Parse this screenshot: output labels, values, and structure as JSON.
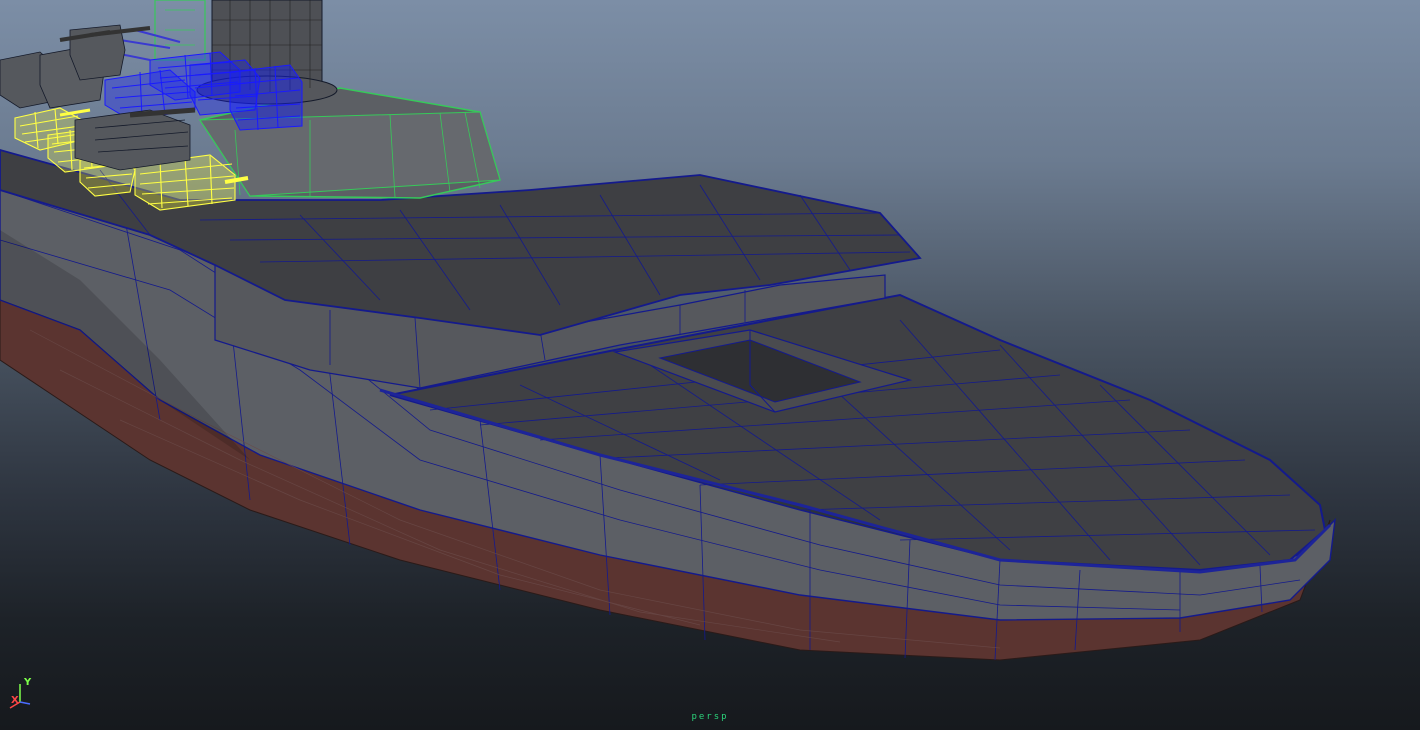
{
  "viewport": {
    "camera_label": "persp",
    "axis": {
      "y_label": "Y",
      "x_label": "X"
    }
  },
  "colors": {
    "background_top": "#7c8ea6",
    "background_bottom": "#16191d",
    "hull_upper": "#5a5d62",
    "hull_lower": "#5b3430",
    "deck": "#3f4044",
    "wireframe_edge": "#141a8c",
    "selected_turret_yellow": "#ffff44",
    "selected_turret_blue": "#1a1aff",
    "selected_superstructure_green": "#37c95a",
    "axis_y": "#7dff4a",
    "axis_x": "#ff4646",
    "camera_label": "#2bd17a"
  },
  "scene": {
    "objects": [
      {
        "name": "hull",
        "selected": false
      },
      {
        "name": "foredeck",
        "selected": false
      },
      {
        "name": "deckhouse",
        "selected": false
      },
      {
        "name": "hatch",
        "selected": false
      },
      {
        "name": "superstructure",
        "selected": true,
        "highlight": "green"
      },
      {
        "name": "funnel",
        "selected": false
      },
      {
        "name": "secondary-turrets",
        "selected": true,
        "highlight": "blue"
      },
      {
        "name": "aa-turrets",
        "selected": true,
        "highlight": "yellow"
      }
    ]
  }
}
